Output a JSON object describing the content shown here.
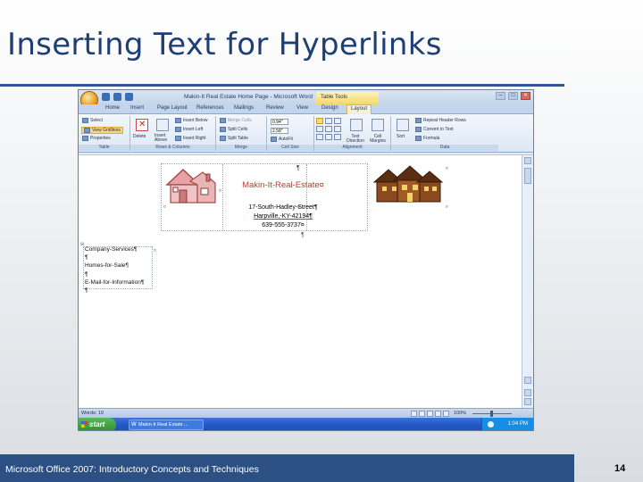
{
  "slide": {
    "title": "Inserting Text for Hyperlinks",
    "footer": "Microsoft Office 2007: Introductory Concepts and Techniques",
    "page_number": "14"
  },
  "word": {
    "window_title": "Makin-It Real Estate Home Page - Microsoft Word",
    "contextual_tab": "Table Tools",
    "ribbon_tabs": [
      "Home",
      "Insert",
      "Page Layout",
      "References",
      "Mailings",
      "Review",
      "View",
      "Design",
      "Layout"
    ],
    "active_tab": "Layout",
    "groups": {
      "table": {
        "label": "Table",
        "select": "Select",
        "view_gridlines": "View Gridlines",
        "properties": "Properties"
      },
      "rows_columns": {
        "label": "Rows & Columns",
        "delete": "Delete",
        "insert_above": "Insert Above",
        "insert_below": "Insert Below",
        "insert_left": "Insert Left",
        "insert_right": "Insert Right"
      },
      "merge": {
        "label": "Merge",
        "merge_cells": "Merge Cells",
        "split_cells": "Split Cells",
        "split_table": "Split Table"
      },
      "cell_size": {
        "label": "Cell Size",
        "height": "0.94\"",
        "width": "2.58\"",
        "autofit": "AutoFit"
      },
      "alignment": {
        "label": "Alignment",
        "text_direction": "Text Direction",
        "cell_margins": "Cell Margins"
      },
      "data": {
        "label": "Data",
        "sort": "Sort",
        "repeat_header_rows": "Repeat Header Rows",
        "convert_to_text": "Convert to Text",
        "formula": "Formula"
      }
    },
    "document": {
      "company_name": "Makin-It-Real-Estate¤",
      "pilcrow_top": "¶",
      "address_street": "17-South-Hadley-Street¶",
      "address_city": "Harpville,-KY-42194¶",
      "address_phone": "639-555-3737¤",
      "after_table": "¶",
      "list_items": [
        "Company-Services¶",
        "¶",
        "Homes-for-Sale¶",
        "¶",
        "E-Mail-for-Information¶",
        "¶"
      ]
    },
    "status": {
      "words": "Words: 19",
      "zoom": "100%"
    },
    "taskbar": {
      "start": "start",
      "task_item": "Makin-It Real Estate ...",
      "clock": "1:04 PM"
    }
  }
}
